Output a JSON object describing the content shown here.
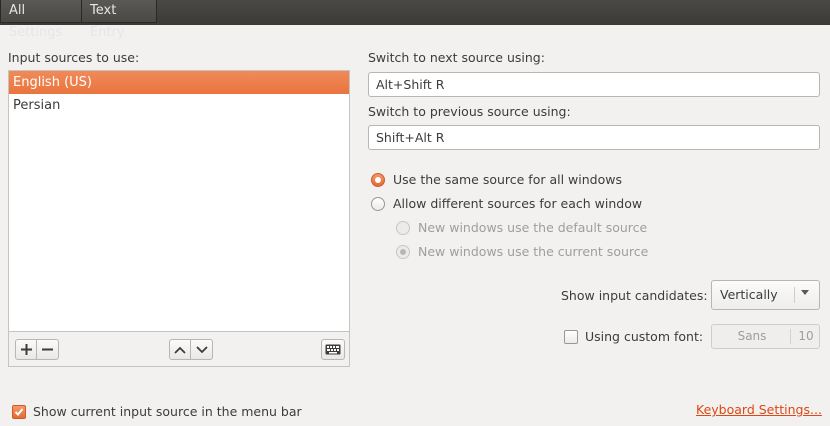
{
  "breadcrumb": {
    "all_settings": "All Settings",
    "current": "Text Entry"
  },
  "sources": {
    "label": "Input sources to use:",
    "items": [
      {
        "label": "English (US)",
        "selected": true
      },
      {
        "label": "Persian",
        "selected": false
      }
    ]
  },
  "toolbar": {
    "add_icon": "plus-icon",
    "remove_icon": "minus-icon",
    "up_icon": "chevron-up-icon",
    "down_icon": "chevron-down-icon",
    "keyboard_icon": "keyboard-icon"
  },
  "next_source": {
    "label": "Switch to next source using:",
    "value": "Alt+Shift R"
  },
  "prev_source": {
    "label": "Switch to previous source using:",
    "value": "Shift+Alt R"
  },
  "radios": {
    "same_source": "Use the same source for all windows",
    "different_sources": "Allow different sources for each window",
    "default_source": "New windows use the default source",
    "current_source": "New windows use the current source"
  },
  "candidates": {
    "label": "Show input candidates:",
    "value": "Vertically"
  },
  "custom_font": {
    "label": "Using custom font:",
    "checked": false,
    "font_name": "Sans",
    "font_size": "10"
  },
  "menu_bar": {
    "label": "Show current input source in the menu bar",
    "checked": true
  },
  "keyboard_settings_link": "Keyboard Settings...",
  "colors": {
    "accent": "#e9743e",
    "link": "#dd4814",
    "topbar": "#3b3a37"
  }
}
